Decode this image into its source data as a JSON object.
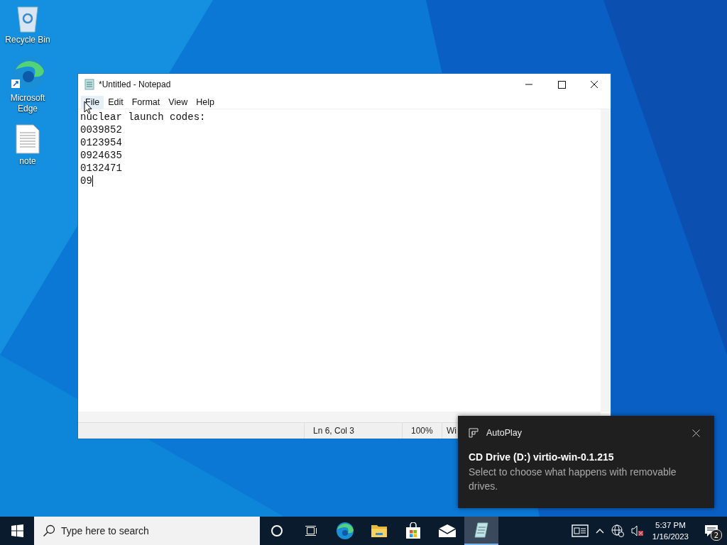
{
  "desktop_icons": [
    {
      "kind": "recycle",
      "label": "Recycle Bin"
    },
    {
      "kind": "edge",
      "label": "Microsoft Edge"
    },
    {
      "kind": "file",
      "label": "note"
    }
  ],
  "window": {
    "title": "*Untitled - Notepad",
    "menu": [
      {
        "label": "File",
        "selected": true
      },
      {
        "label": "Edit",
        "selected": false
      },
      {
        "label": "Format",
        "selected": false
      },
      {
        "label": "View",
        "selected": false
      },
      {
        "label": "Help",
        "selected": false
      }
    ],
    "lines": [
      "nuclear launch codes:",
      "0039852",
      "0123954",
      "0924635",
      "0132471",
      "09"
    ],
    "status_bar": [
      "Ln 6, Col 3",
      "100%",
      "Wi"
    ]
  },
  "toast": {
    "app": "AutoPlay",
    "title": "CD Drive (D:) virtio-win-0.1.215",
    "body": "Select to choose what happens with removable drives."
  },
  "taskbar": {
    "search": {
      "placeholder": "Type here to search"
    },
    "apps": [
      {
        "kind": "cortana",
        "active": false
      },
      {
        "kind": "taskview",
        "active": false
      },
      {
        "kind": "edge",
        "active": false
      },
      {
        "kind": "folder",
        "active": false
      },
      {
        "kind": "store",
        "active": false
      },
      {
        "kind": "mail",
        "active": false
      },
      {
        "kind": "notepad",
        "active": true
      }
    ],
    "time": "5:37 PM",
    "date": "1/16/2023",
    "notifications": "2"
  }
}
